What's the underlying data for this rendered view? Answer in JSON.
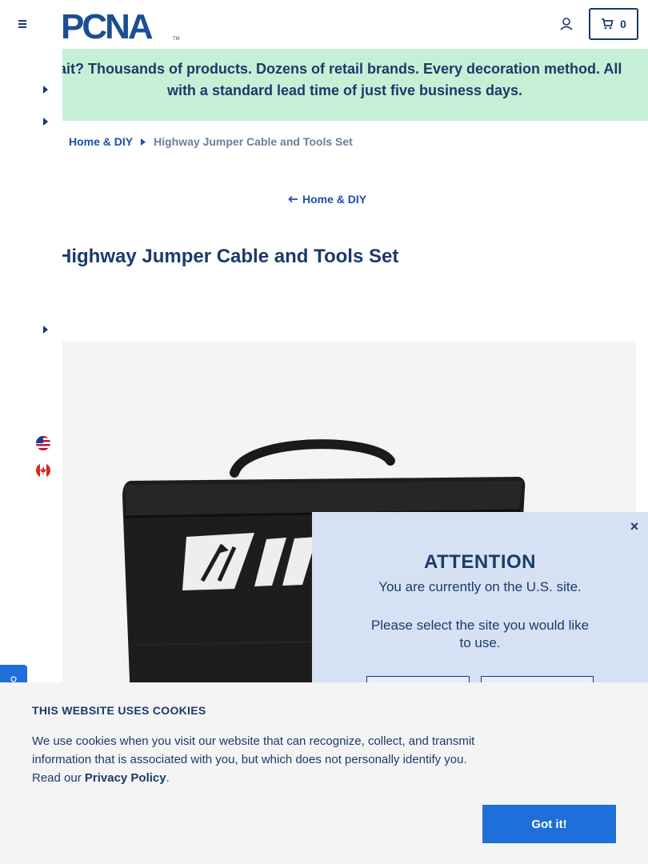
{
  "header": {
    "logo_text": "PCNA",
    "logo_mark": "TM",
    "cart_count": "0"
  },
  "banner": {
    "line1": "Wait? Thousands of products. Dozens of retail brands. Every decoration method. All",
    "line2": "with a standard lead time of just five business days."
  },
  "breadcrumb": {
    "category": "Home & DIY",
    "current": "Highway Jumper Cable and Tools Set"
  },
  "back_link": "Home & DIY",
  "product": {
    "title": "Highway Jumper Cable and Tools Set"
  },
  "modal": {
    "title": "ATTENTION",
    "message": "You are currently on the U.S. site.",
    "prompt": "Please select the site you would like to use.",
    "close_symbol": "×"
  },
  "cookie": {
    "title": "THIS WEBSITE USES COOKIES",
    "text": "We use cookies when you visit our website that can recognize, collect, and transmit information that is associated with you, but which does not personally identify you. Read our ",
    "link": "Privacy Policy",
    "period": ".",
    "button": "Got it!"
  },
  "colors": {
    "brand_navy": "#1b3a6b",
    "link_blue": "#1e4fa8",
    "banner_green": "#c6f0d6",
    "modal_bg": "#d6e2f4",
    "button_blue": "#1e6fd9"
  },
  "icons": {
    "menu": "hamburger-icon",
    "account": "user-icon",
    "cart": "cart-icon",
    "back": "arrow-left-icon",
    "breadcrumb_sep": "caret-right-icon",
    "flags": [
      "us-flag-icon",
      "canada-flag-icon"
    ]
  }
}
